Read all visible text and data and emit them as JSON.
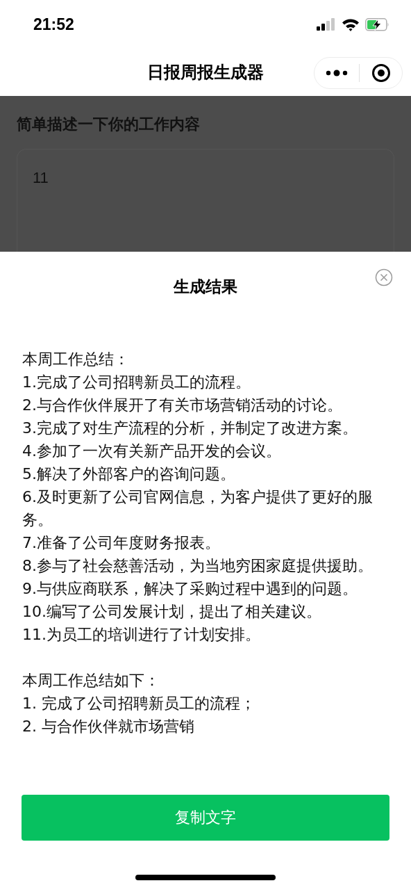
{
  "status_bar": {
    "time": "21:52"
  },
  "nav_bar": {
    "title": "日报周报生成器"
  },
  "background_form": {
    "label": "简单描述一下你的工作内容",
    "value": "11"
  },
  "result_sheet": {
    "title": "生成结果",
    "paragraphs": [
      {
        "lines": [
          "本周工作总结：",
          "1.完成了公司招聘新员工的流程。",
          "2.与合作伙伴展开了有关市场营销活动的讨论。",
          "3.完成了对生产流程的分析，并制定了改进方案。",
          "4.参加了一次有关新产品开发的会议。",
          "5.解决了外部客户的咨询问题。",
          "6.及时更新了公司官网信息，为客户提供了更好的服务。",
          "7.准备了公司年度财务报表。",
          "8.参与了社会慈善活动，为当地穷困家庭提供援助。",
          "9.与供应商联系，解决了采购过程中遇到的问题。",
          "10.编写了公司发展计划，提出了相关建议。",
          "11.为员工的培训进行了计划安排。"
        ]
      },
      {
        "lines": [
          "本周工作总结如下：",
          "1. 完成了公司招聘新员工的流程；",
          "2. 与合作伙伴就市场营销"
        ]
      }
    ],
    "button": "复制文字"
  }
}
